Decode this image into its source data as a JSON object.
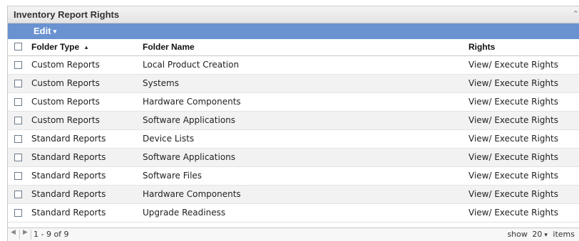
{
  "panel": {
    "title": "Inventory Report Rights",
    "collapse_icon": "collapse-icon"
  },
  "toolbar": {
    "edit_label": "Edit",
    "edit_caret": "▾"
  },
  "table": {
    "headers": {
      "folder_type": "Folder Type",
      "folder_name": "Folder Name",
      "rights": "Rights"
    },
    "sort_indicator": "▲",
    "rows": [
      {
        "folder_type": "Custom Reports",
        "folder_name": "Local Product Creation",
        "rights": "View/ Execute Rights"
      },
      {
        "folder_type": "Custom Reports",
        "folder_name": "Systems",
        "rights": "View/ Execute Rights"
      },
      {
        "folder_type": "Custom Reports",
        "folder_name": "Hardware Components",
        "rights": "View/ Execute Rights"
      },
      {
        "folder_type": "Custom Reports",
        "folder_name": "Software Applications",
        "rights": "View/ Execute Rights"
      },
      {
        "folder_type": "Standard Reports",
        "folder_name": "Device Lists",
        "rights": "View/ Execute Rights"
      },
      {
        "folder_type": "Standard Reports",
        "folder_name": "Software Applications",
        "rights": "View/ Execute Rights"
      },
      {
        "folder_type": "Standard Reports",
        "folder_name": "Software Files",
        "rights": "View/ Execute Rights"
      },
      {
        "folder_type": "Standard Reports",
        "folder_name": "Hardware Components",
        "rights": "View/ Execute Rights"
      },
      {
        "folder_type": "Standard Reports",
        "folder_name": "Upgrade Readiness",
        "rights": "View/ Execute Rights"
      }
    ]
  },
  "footer": {
    "range": "1 - 9 of 9",
    "show_label": "show",
    "page_size": "20",
    "items_label": "items",
    "prev_icon": "◀",
    "next_icon": "▶"
  },
  "colors": {
    "toolbar": "#6a92d1",
    "alt_row": "#f2f2f2"
  }
}
